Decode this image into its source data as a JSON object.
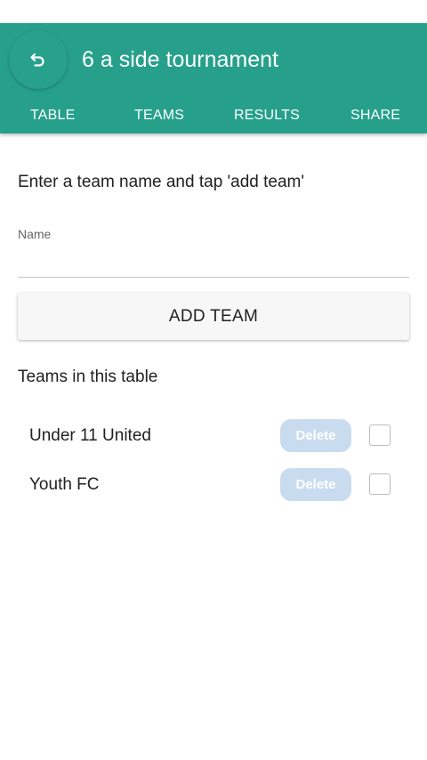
{
  "app_bar": {
    "title": "6 a side tournament",
    "back_icon": "undo-arrow-icon",
    "color": "#26a08b"
  },
  "tabs": [
    {
      "label": "TABLE"
    },
    {
      "label": "TEAMS"
    },
    {
      "label": "RESULTS"
    },
    {
      "label": "SHARE"
    }
  ],
  "form": {
    "instructions": "Enter a team name and tap 'add team'",
    "name_label": "Name",
    "name_value": "",
    "add_button_label": "ADD TEAM"
  },
  "teams_section": {
    "heading": "Teams in this table",
    "teams": [
      {
        "name": "Under 11 United",
        "delete_label": "Delete",
        "checked": false
      },
      {
        "name": "Youth FC",
        "delete_label": "Delete",
        "checked": false
      }
    ]
  }
}
